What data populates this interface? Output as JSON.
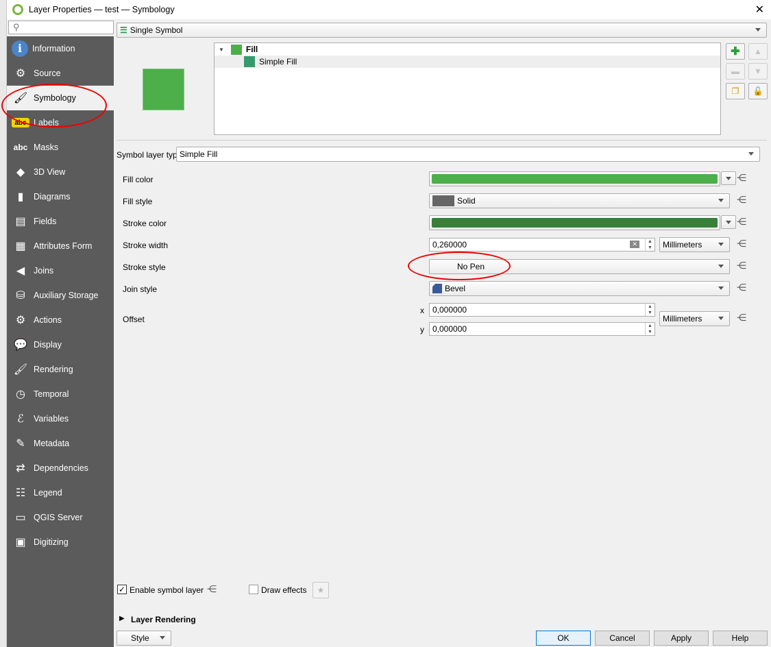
{
  "window": {
    "title": "Layer Properties — test — Symbology"
  },
  "search": {
    "placeholder": ""
  },
  "sidebar": {
    "items": [
      {
        "label": "Information",
        "icon": "info-icon"
      },
      {
        "label": "Source",
        "icon": "source-icon"
      },
      {
        "label": "Symbology",
        "icon": "symbology-icon",
        "selected": true
      },
      {
        "label": "Labels",
        "icon": "labels-icon"
      },
      {
        "label": "Masks",
        "icon": "masks-icon"
      },
      {
        "label": "3D View",
        "icon": "3d-view-icon"
      },
      {
        "label": "Diagrams",
        "icon": "diagrams-icon"
      },
      {
        "label": "Fields",
        "icon": "fields-icon"
      },
      {
        "label": "Attributes Form",
        "icon": "attributes-form-icon"
      },
      {
        "label": "Joins",
        "icon": "joins-icon"
      },
      {
        "label": "Auxiliary Storage",
        "icon": "auxiliary-storage-icon"
      },
      {
        "label": "Actions",
        "icon": "actions-icon"
      },
      {
        "label": "Display",
        "icon": "display-icon"
      },
      {
        "label": "Rendering",
        "icon": "rendering-icon"
      },
      {
        "label": "Temporal",
        "icon": "temporal-icon"
      },
      {
        "label": "Variables",
        "icon": "variables-icon"
      },
      {
        "label": "Metadata",
        "icon": "metadata-icon"
      },
      {
        "label": "Dependencies",
        "icon": "dependencies-icon"
      },
      {
        "label": "Legend",
        "icon": "legend-icon"
      },
      {
        "label": "QGIS Server",
        "icon": "qgis-server-icon"
      },
      {
        "label": "Digitizing",
        "icon": "digitizing-icon"
      }
    ]
  },
  "renderer": {
    "value": "Single Symbol"
  },
  "tree": {
    "root": "Fill",
    "child": "Simple Fill"
  },
  "colors": {
    "fill": "#4caf4a",
    "stroke": "#368039",
    "sidebar": "#5b5b5b",
    "annotation": "#e00000"
  },
  "symbol_layer_type": {
    "label": "Symbol layer type",
    "value": "Simple Fill"
  },
  "props": {
    "fill_color": "Fill color",
    "fill_style": "Fill style",
    "fill_style_value": "Solid",
    "stroke_color": "Stroke color",
    "stroke_width": "Stroke width",
    "stroke_width_value": "0,260000",
    "stroke_width_unit": "Millimeters",
    "stroke_style": "Stroke style",
    "stroke_style_value": "No Pen",
    "join_style": "Join style",
    "join_style_value": "Bevel",
    "offset": "Offset",
    "x_label": "x",
    "x_value": "0,000000",
    "y_label": "y",
    "y_value": "0,000000",
    "offset_unit": "Millimeters"
  },
  "footer": {
    "enable_symbol_layer": "Enable symbol layer",
    "enable_checked": true,
    "draw_effects": "Draw effects",
    "draw_checked": false,
    "layer_rendering": "Layer Rendering"
  },
  "buttons": {
    "style": "Style",
    "ok": "OK",
    "cancel": "Cancel",
    "apply": "Apply",
    "help": "Help"
  }
}
